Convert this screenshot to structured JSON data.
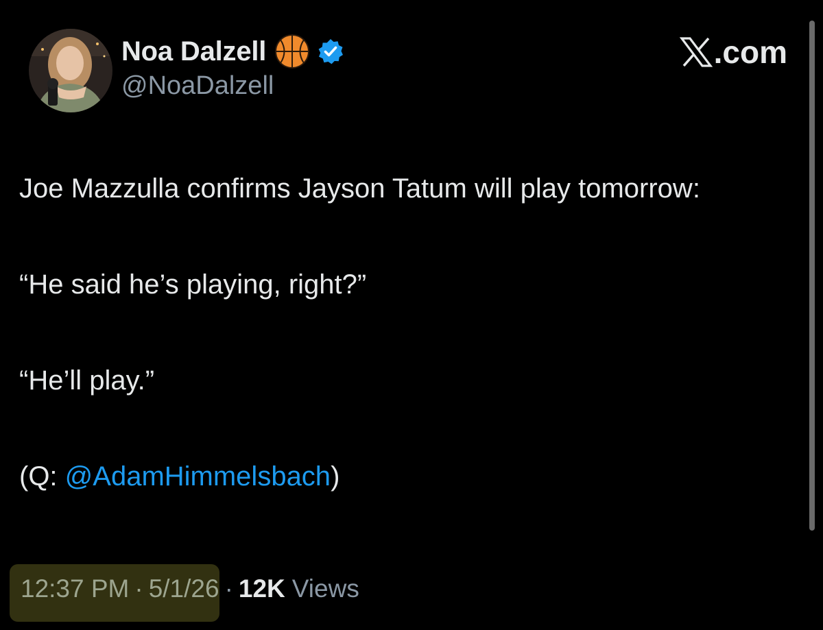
{
  "author": {
    "display_name": "Noa Dalzell",
    "handle": "@NoaDalzell",
    "badge_emoji_icon": "basketball-icon",
    "verified_icon": "verified-badge-icon",
    "verified_color": "#1d9bf0"
  },
  "site": {
    "brand": ".com",
    "logo_icon": "x-logo-icon"
  },
  "tweet": {
    "line1": "Joe Mazzulla confirms Jayson Tatum will play tomorrow:",
    "quote1": "“He said he’s playing, right?”",
    "quote2": "“He’ll play.”",
    "credit_prefix": "(Q: ",
    "credit_mention": "@AdamHimmelsbach",
    "credit_suffix": ")",
    "mention_color": "#1d9bf0"
  },
  "meta": {
    "time": "12:37 PM",
    "separator": "·",
    "date": "5/1/26",
    "views_count": "12K",
    "views_label": "Views"
  }
}
